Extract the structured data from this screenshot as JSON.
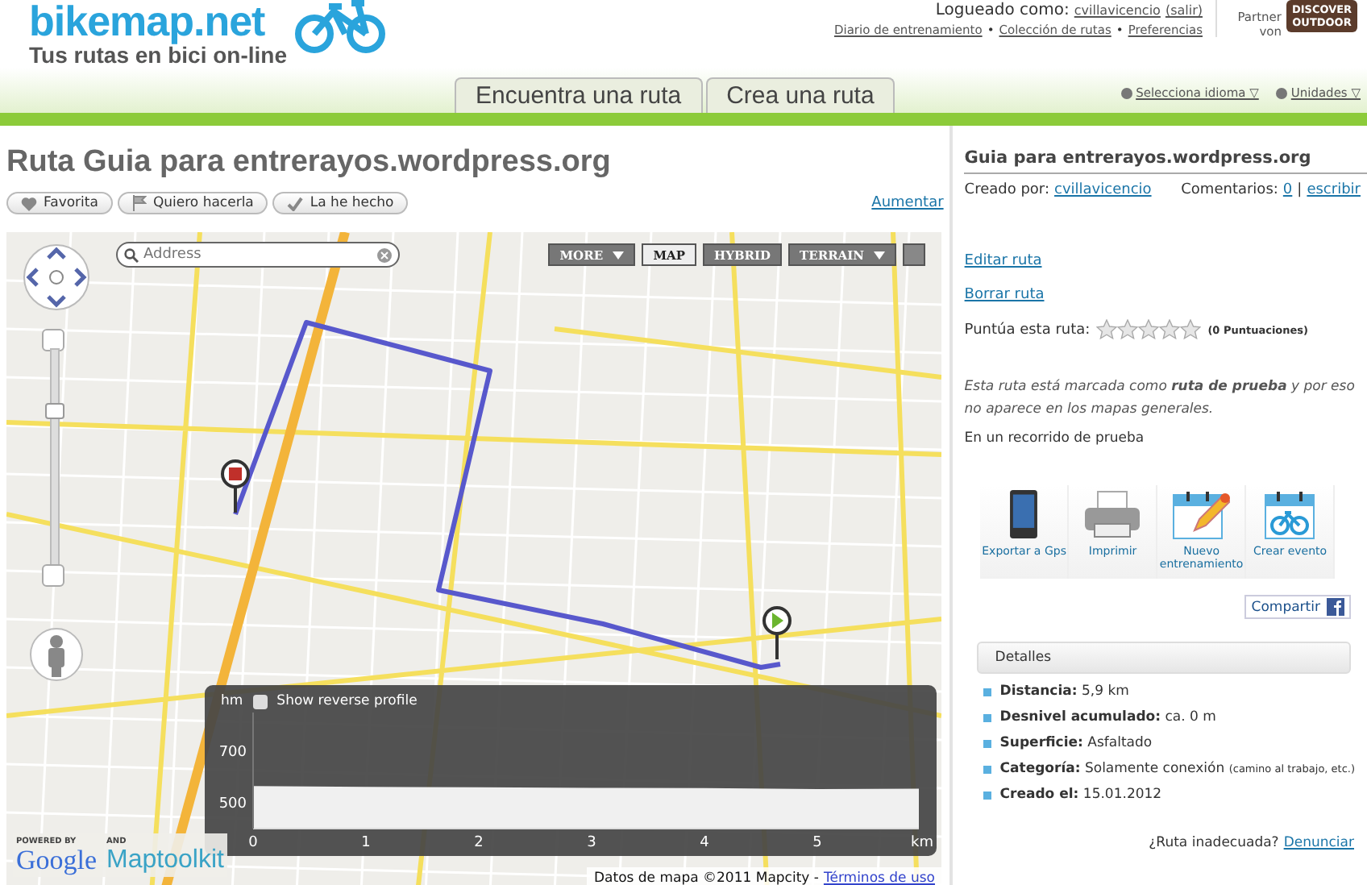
{
  "header": {
    "logo": "bikemap.net",
    "tagline": "Tus rutas en bici on-line",
    "login_label": "Logueado como:",
    "username": "cvillavicencio",
    "logout": "(salir)",
    "user_links": [
      "Diario de entrenamiento",
      "Colección de rutas",
      "Preferencias"
    ],
    "link_separator": "•",
    "partner_label": "Partner von",
    "partner_logo": "DISCOVER OUTDOOR"
  },
  "nav": {
    "tabs": [
      {
        "label": "Encuentra una ruta",
        "selected": false
      },
      {
        "label": "Crea una ruta",
        "selected": false
      }
    ],
    "links": [
      "Selecciona idioma ▽",
      "Unidades ▽"
    ]
  },
  "route": {
    "title": "Ruta Guia para entrerayos.wordpress.org",
    "actions": [
      {
        "label": "Favorita",
        "kind": "heart"
      },
      {
        "label": "Quiero hacerla",
        "kind": "flag"
      },
      {
        "label": "La he hecho",
        "kind": "check"
      }
    ],
    "enlarge": "Aumentar"
  },
  "map": {
    "search": {
      "placeholder": "Address"
    },
    "map_types": [
      {
        "label": "MORE",
        "kind": "dropdown",
        "selected": false
      },
      {
        "label": "MAP",
        "kind": "button",
        "selected": true
      },
      {
        "label": "HYBRID",
        "kind": "button",
        "selected": false
      },
      {
        "label": "TERRAIN",
        "kind": "dropdown",
        "selected": false
      }
    ],
    "zoom": {
      "level": 0.74
    },
    "powered_by": "POWERED BY",
    "google": "Google",
    "and_label": "AND",
    "maptoolkit": "Maptoolkit",
    "attribution": "Datos de mapa ©2011 Mapcity -",
    "terms": "Términos de uso",
    "profile": {
      "unit": "hm",
      "reverse_label": "Show reverse profile",
      "reverse_checked": false,
      "x_unit": "km",
      "chart_data": {
        "type": "area",
        "x": [
          0,
          1,
          2,
          3,
          4,
          5,
          5.9
        ],
        "series": [
          {
            "color": "#f0f0f0",
            "values": [
              565,
              562,
              560,
              558,
              557,
              553,
              555
            ]
          }
        ],
        "xlim": [
          0,
          5.9
        ],
        "ylim": [
          400,
          850
        ],
        "xticks": [
          0,
          1,
          2,
          3,
          4,
          5
        ],
        "yticks": [
          500,
          700
        ]
      }
    }
  },
  "sidebar": {
    "title": "Guia para entrerayos.wordpress.org",
    "created_by_label": "Creado por:",
    "author": "cvillavicencio",
    "comments_label": "Comentarios:",
    "comments_count": "0",
    "comments_separator": "|",
    "write_link": "escribir",
    "links": [
      "Editar ruta",
      "Borrar ruta"
    ],
    "rating_label": "Puntúa esta ruta:",
    "stars": 0,
    "rating_count": "(0 Puntuaciones)",
    "notice": "Esta ruta está marcada como **ruta de prueba** y por eso no aparece en los mapas generales.",
    "status": "En un recorrido de prueba",
    "tools": [
      {
        "label": "Exportar a Gps",
        "kind": "phone"
      },
      {
        "label": "Imprimir",
        "kind": "printer"
      },
      {
        "label": "Nuevo entrenamiento",
        "kind": "calendar-pencil"
      },
      {
        "label": "Crear evento",
        "kind": "calendar-bike"
      }
    ],
    "share": "Compartir",
    "details_title": "Detalles",
    "details": [
      {
        "label": "Distancia:",
        "value": "5,9 km"
      },
      {
        "label": "Desnivel acumulado:",
        "value": "ca. 0 m"
      },
      {
        "label": "Superficie:",
        "value": "Asfaltado"
      },
      {
        "label": "Categoría:",
        "value": "Solamente conexión",
        "note": "(camino al trabajo, etc.)"
      },
      {
        "label": "Creado el:",
        "value": "15.01.2012"
      }
    ],
    "report_label": "¿Ruta inadecuada?",
    "report_link": "Denunciar"
  }
}
